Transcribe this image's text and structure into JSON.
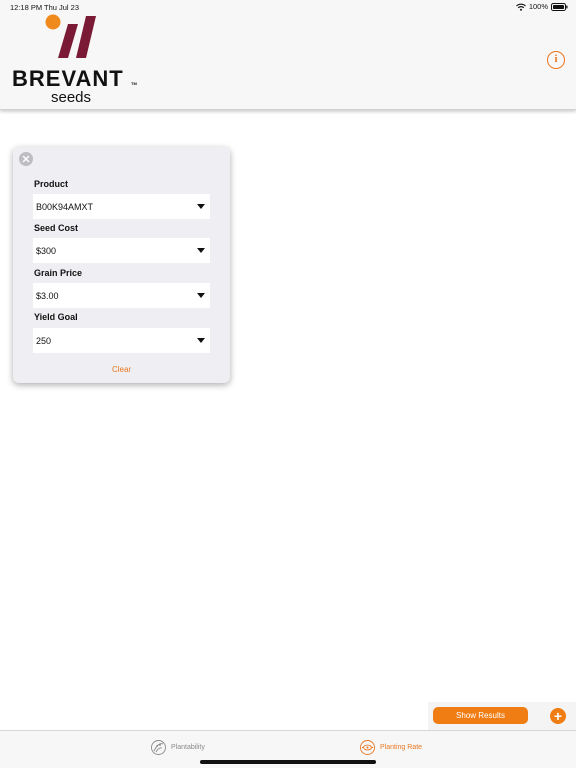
{
  "status_bar": {
    "time": "12:18 PM",
    "date": "Thu Jul 23",
    "battery": "100%"
  },
  "header": {
    "brand": "BREVANT",
    "trademark": "TM",
    "brand_sub": "seeds",
    "info_icon": "info-icon"
  },
  "calculator": {
    "fields": [
      {
        "label": "Product",
        "value": "B00K94AMXT"
      },
      {
        "label": "Seed Cost",
        "value": "$300"
      },
      {
        "label": "Grain Price",
        "value": "$3.00"
      },
      {
        "label": "Yield Goal",
        "value": "250"
      }
    ],
    "clear_label": "Clear"
  },
  "actions": {
    "show_results_label": "Show Results",
    "add_label": "+"
  },
  "tabs": [
    {
      "label": "Plantability",
      "icon": "plantability-icon",
      "active": false
    },
    {
      "label": "Planting Rate",
      "icon": "planting-rate-icon",
      "active": true
    }
  ],
  "colors": {
    "accent": "#f07d14",
    "brand_maroon": "#7a1a35",
    "brand_orange": "#f08a1c"
  }
}
